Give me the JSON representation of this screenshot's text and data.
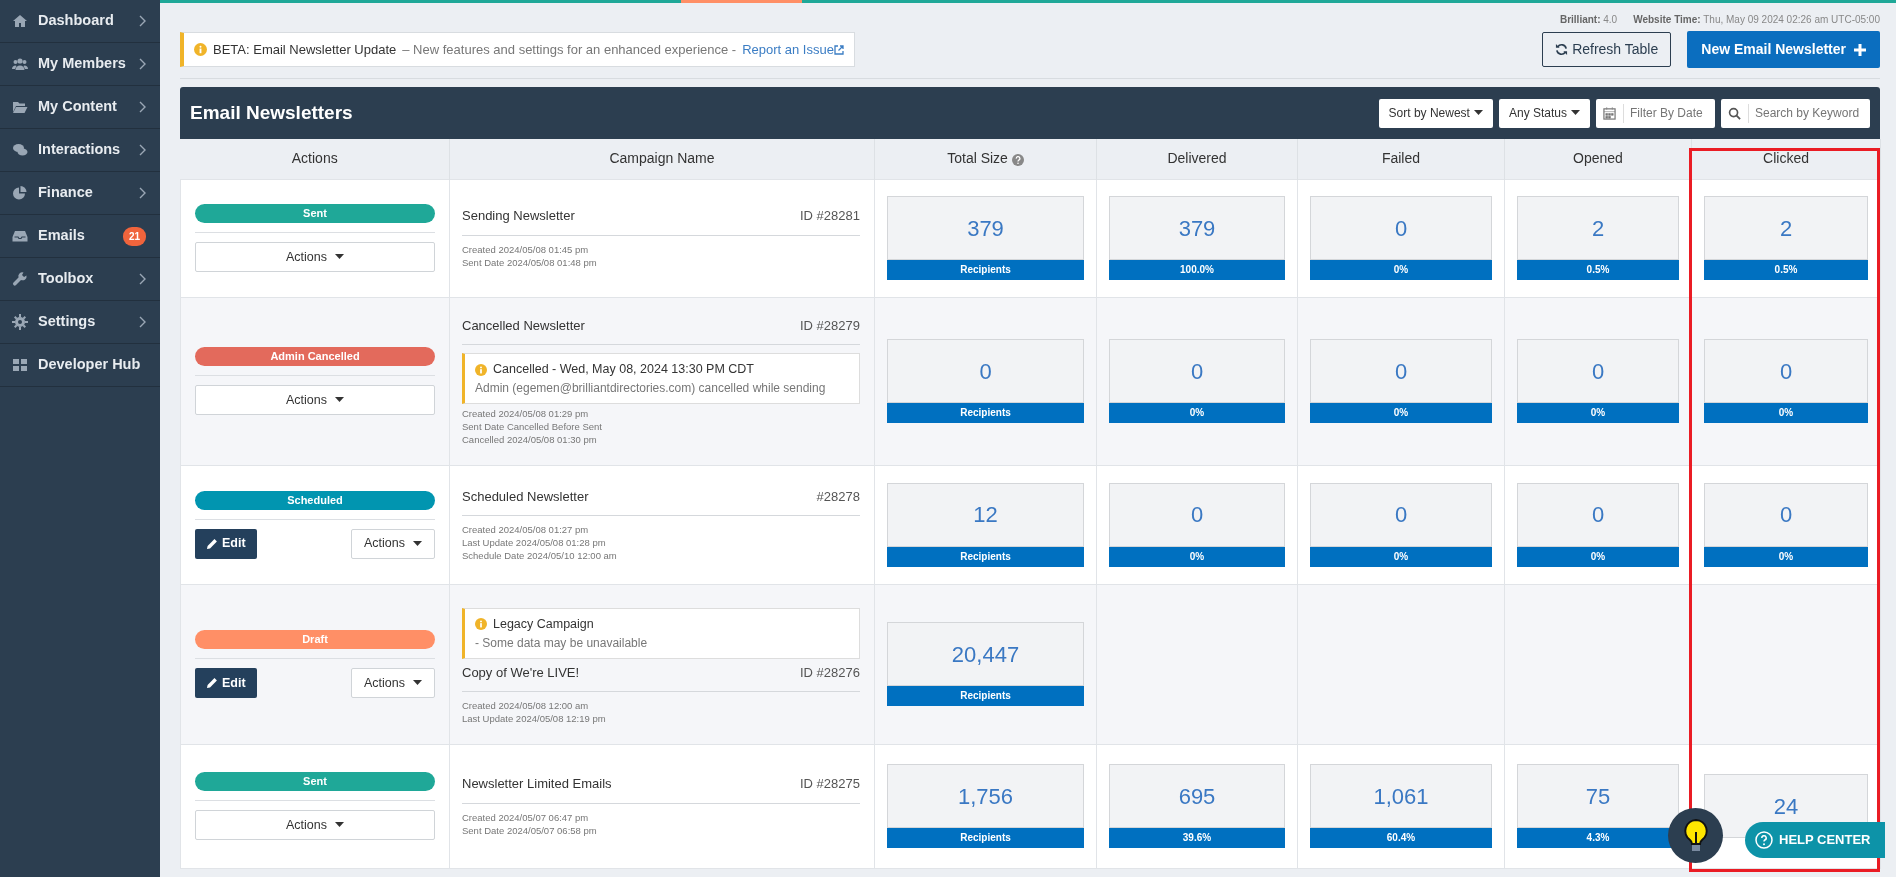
{
  "sidebar": {
    "items": [
      {
        "label": "Dashboard",
        "submenu": true
      },
      {
        "label": "My Members",
        "submenu": true
      },
      {
        "label": "My Content",
        "submenu": true
      },
      {
        "label": "Interactions",
        "submenu": true
      },
      {
        "label": "Finance",
        "submenu": true
      },
      {
        "label": "Emails",
        "submenu": false,
        "badge": "21"
      },
      {
        "label": "Toolbox",
        "submenu": true
      },
      {
        "label": "Settings",
        "submenu": true
      },
      {
        "label": "Developer Hub",
        "submenu": false
      }
    ]
  },
  "meta": {
    "version_label": "Brilliant:",
    "version": "4.0",
    "time_label": "Website Time:",
    "time": "Thu, May 09 2024 02:26 am UTC-05:00"
  },
  "banner": {
    "title": "BETA: Email Newsletter Update",
    "text": "– New features and settings for an enhanced experience -",
    "link": "Report an Issue"
  },
  "toolbar": {
    "refresh": "Refresh Table",
    "create": "New Email Newsletter"
  },
  "panel": {
    "title": "Email Newsletters",
    "sort": "Sort by Newest",
    "status": "Any Status",
    "date_placeholder": "Filter By Date",
    "search_placeholder": "Search by Keyword"
  },
  "table": {
    "columns": [
      {
        "label": "Actions",
        "help": false
      },
      {
        "label": "Campaign Name",
        "help": false
      },
      {
        "label": "Total Size",
        "help": true
      },
      {
        "label": "Delivered",
        "help": false
      },
      {
        "label": "Failed",
        "help": false
      },
      {
        "label": "Opened",
        "help": false
      },
      {
        "label": "Clicked",
        "help": false
      }
    ],
    "rows": [
      {
        "status": {
          "label": "Sent",
          "color": "#1fa898"
        },
        "actions": "Actions",
        "campaign": [
          {
            "kind": "title",
            "name": "Sending Newsletter",
            "id": "ID #28281"
          },
          {
            "kind": "dates",
            "lines": [
              "Created 2024/05/08 01:45 pm",
              "Sent Date 2024/05/08 01:48 pm"
            ]
          }
        ],
        "stats": {
          "total": {
            "value": "379",
            "caption": "Recipients"
          },
          "delivered": {
            "value": "379",
            "caption": "100.0%"
          },
          "failed": {
            "value": "0",
            "caption": "0%"
          },
          "opened": {
            "value": "2",
            "caption": "0.5%"
          },
          "clicked": {
            "value": "2",
            "caption": "0.5%"
          }
        }
      },
      {
        "status": {
          "label": "Admin Cancelled",
          "color": "#e36a5c"
        },
        "actions": "Actions",
        "campaign": [
          {
            "kind": "title",
            "name": "Cancelled Newsletter",
            "id": "ID #28279"
          },
          {
            "kind": "notice",
            "title": "Cancelled - Wed, May 08, 2024 13:30 PM CDT",
            "text": "Admin (egemen@brilliantdirectories.com) cancelled while sending"
          },
          {
            "kind": "dates",
            "lines": [
              "Created 2024/05/08 01:29 pm",
              "Sent Date Cancelled Before Sent",
              "Cancelled 2024/05/08 01:30 pm"
            ]
          }
        ],
        "stats": {
          "total": {
            "value": "0",
            "caption": "Recipients"
          },
          "delivered": {
            "value": "0",
            "caption": "0%"
          },
          "failed": {
            "value": "0",
            "caption": "0%"
          },
          "opened": {
            "value": "0",
            "caption": "0%"
          },
          "clicked": {
            "value": "0",
            "caption": "0%"
          }
        }
      },
      {
        "status": {
          "label": "Scheduled",
          "color": "#0195b0"
        },
        "edit": "Edit",
        "actions": "Actions",
        "campaign": [
          {
            "kind": "title",
            "name": "Scheduled Newsletter",
            "id": "#28278"
          },
          {
            "kind": "dates",
            "lines": [
              "Created 2024/05/08 01:27 pm",
              "Last Update 2024/05/08 01:28 pm",
              "Schedule Date 2024/05/10 12:00 am"
            ]
          }
        ],
        "stats": {
          "total": {
            "value": "12",
            "caption": "Recipients"
          },
          "delivered": {
            "value": "0",
            "caption": "0%"
          },
          "failed": {
            "value": "0",
            "caption": "0%"
          },
          "opened": {
            "value": "0",
            "caption": "0%"
          },
          "clicked": {
            "value": "0",
            "caption": "0%"
          }
        }
      },
      {
        "status": {
          "label": "Draft",
          "color": "#ff8f66"
        },
        "edit": "Edit",
        "actions": "Actions",
        "campaign": [
          {
            "kind": "notice",
            "title": "Legacy Campaign",
            "text": "- Some data may be unavailable"
          },
          {
            "kind": "title",
            "name": "Copy of We're LIVE!",
            "id": "ID #28276"
          },
          {
            "kind": "dates",
            "lines": [
              "Created 2024/05/08 12:00 am",
              "Last Update 2024/05/08 12:19 pm"
            ]
          }
        ],
        "stats": {
          "total": {
            "value": "20,447",
            "caption": "Recipients"
          }
        }
      },
      {
        "status": {
          "label": "Sent",
          "color": "#1fa898"
        },
        "actions": "Actions",
        "campaign": [
          {
            "kind": "title",
            "name": "Newsletter Limited Emails",
            "id": "ID #28275"
          },
          {
            "kind": "dates",
            "lines": [
              "Created 2024/05/07 06:47 pm",
              "Sent Date 2024/05/07 06:58 pm"
            ]
          }
        ],
        "stats": {
          "total": {
            "value": "1,756",
            "caption": "Recipients"
          },
          "delivered": {
            "value": "695",
            "caption": "39.6%"
          },
          "failed": {
            "value": "1,061",
            "caption": "60.4%"
          },
          "opened": {
            "value": "75",
            "caption": "4.3%"
          },
          "clicked": {
            "value": "24"
          }
        }
      }
    ]
  },
  "help": {
    "label": "HELP CENTER"
  }
}
